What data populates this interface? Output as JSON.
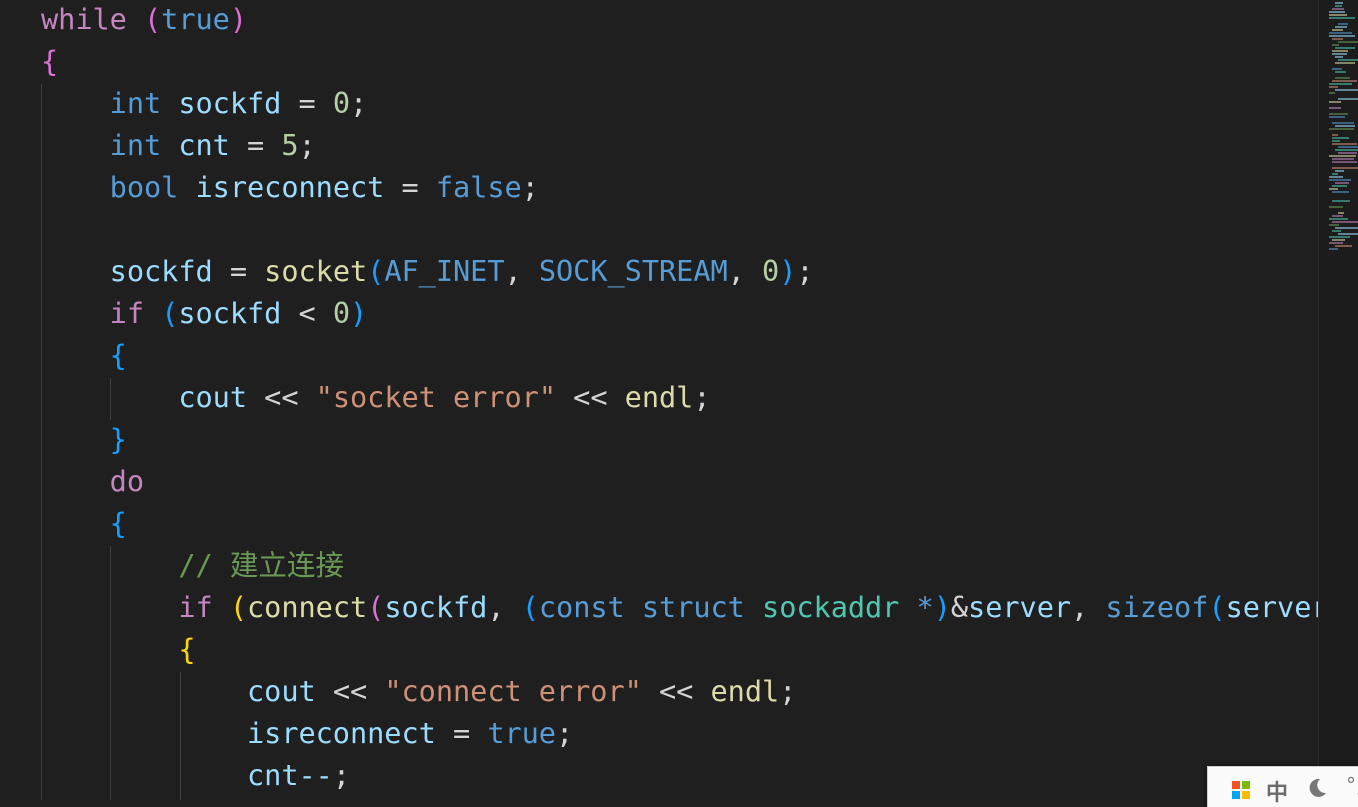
{
  "editor": {
    "language": "cpp",
    "lines": [
      [
        {
          "t": "while",
          "c": "kw-ctrl"
        },
        {
          "t": " ",
          "c": "op"
        },
        {
          "t": "(",
          "c": "p1"
        },
        {
          "t": "true",
          "c": "kw"
        },
        {
          "t": ")",
          "c": "p1"
        }
      ],
      [
        {
          "t": "{",
          "c": "p1"
        }
      ],
      [
        {
          "t": "    ",
          "c": "op"
        },
        {
          "t": "int",
          "c": "kw"
        },
        {
          "t": " ",
          "c": "op"
        },
        {
          "t": "sockfd",
          "c": "var"
        },
        {
          "t": " = ",
          "c": "op"
        },
        {
          "t": "0",
          "c": "num"
        },
        {
          "t": ";",
          "c": "op"
        }
      ],
      [
        {
          "t": "    ",
          "c": "op"
        },
        {
          "t": "int",
          "c": "kw"
        },
        {
          "t": " ",
          "c": "op"
        },
        {
          "t": "cnt",
          "c": "var"
        },
        {
          "t": " = ",
          "c": "op"
        },
        {
          "t": "5",
          "c": "num"
        },
        {
          "t": ";",
          "c": "op"
        }
      ],
      [
        {
          "t": "    ",
          "c": "op"
        },
        {
          "t": "bool",
          "c": "kw"
        },
        {
          "t": " ",
          "c": "op"
        },
        {
          "t": "isreconnect",
          "c": "var"
        },
        {
          "t": " = ",
          "c": "op"
        },
        {
          "t": "false",
          "c": "kw"
        },
        {
          "t": ";",
          "c": "op"
        }
      ],
      [],
      [
        {
          "t": "    ",
          "c": "op"
        },
        {
          "t": "sockfd",
          "c": "var"
        },
        {
          "t": " = ",
          "c": "op"
        },
        {
          "t": "socket",
          "c": "fn"
        },
        {
          "t": "(",
          "c": "p2"
        },
        {
          "t": "AF_INET",
          "c": "kw"
        },
        {
          "t": ", ",
          "c": "op"
        },
        {
          "t": "SOCK_STREAM",
          "c": "kw"
        },
        {
          "t": ", ",
          "c": "op"
        },
        {
          "t": "0",
          "c": "num"
        },
        {
          "t": ")",
          "c": "p2"
        },
        {
          "t": ";",
          "c": "op"
        }
      ],
      [
        {
          "t": "    ",
          "c": "op"
        },
        {
          "t": "if",
          "c": "kw-ctrl"
        },
        {
          "t": " ",
          "c": "op"
        },
        {
          "t": "(",
          "c": "p2"
        },
        {
          "t": "sockfd",
          "c": "var"
        },
        {
          "t": " < ",
          "c": "op"
        },
        {
          "t": "0",
          "c": "num"
        },
        {
          "t": ")",
          "c": "p2"
        }
      ],
      [
        {
          "t": "    ",
          "c": "op"
        },
        {
          "t": "{",
          "c": "p2"
        }
      ],
      [
        {
          "t": "        ",
          "c": "op"
        },
        {
          "t": "cout",
          "c": "var"
        },
        {
          "t": " << ",
          "c": "op"
        },
        {
          "t": "\"socket error\"",
          "c": "str"
        },
        {
          "t": " << ",
          "c": "op"
        },
        {
          "t": "endl",
          "c": "fn"
        },
        {
          "t": ";",
          "c": "op"
        }
      ],
      [
        {
          "t": "    ",
          "c": "op"
        },
        {
          "t": "}",
          "c": "p2"
        }
      ],
      [
        {
          "t": "    ",
          "c": "op"
        },
        {
          "t": "do",
          "c": "kw-ctrl"
        }
      ],
      [
        {
          "t": "    ",
          "c": "op"
        },
        {
          "t": "{",
          "c": "p2"
        }
      ],
      [
        {
          "t": "        ",
          "c": "op"
        },
        {
          "t": "// 建立连接",
          "c": "cmt"
        }
      ],
      [
        {
          "t": "        ",
          "c": "op"
        },
        {
          "t": "if",
          "c": "kw-ctrl"
        },
        {
          "t": " ",
          "c": "op"
        },
        {
          "t": "(",
          "c": "p3"
        },
        {
          "t": "connect",
          "c": "fn"
        },
        {
          "t": "(",
          "c": "p1"
        },
        {
          "t": "sockfd",
          "c": "var"
        },
        {
          "t": ", ",
          "c": "op"
        },
        {
          "t": "(",
          "c": "p2"
        },
        {
          "t": "const",
          "c": "kw"
        },
        {
          "t": " ",
          "c": "op"
        },
        {
          "t": "struct",
          "c": "kw"
        },
        {
          "t": " ",
          "c": "op"
        },
        {
          "t": "sockaddr",
          "c": "type"
        },
        {
          "t": " ",
          "c": "op"
        },
        {
          "t": "*",
          "c": "kw"
        },
        {
          "t": ")",
          "c": "p2"
        },
        {
          "t": "&",
          "c": "op"
        },
        {
          "t": "server",
          "c": "var"
        },
        {
          "t": ", ",
          "c": "op"
        },
        {
          "t": "sizeof",
          "c": "kw"
        },
        {
          "t": "(",
          "c": "p2"
        },
        {
          "t": "server",
          "c": "var"
        }
      ],
      [
        {
          "t": "        ",
          "c": "op"
        },
        {
          "t": "{",
          "c": "p3"
        }
      ],
      [
        {
          "t": "            ",
          "c": "op"
        },
        {
          "t": "cout",
          "c": "var"
        },
        {
          "t": " << ",
          "c": "op"
        },
        {
          "t": "\"connect error\"",
          "c": "str"
        },
        {
          "t": " << ",
          "c": "op"
        },
        {
          "t": "endl",
          "c": "fn"
        },
        {
          "t": ";",
          "c": "op"
        }
      ],
      [
        {
          "t": "            ",
          "c": "op"
        },
        {
          "t": "isreconnect",
          "c": "var"
        },
        {
          "t": " = ",
          "c": "op"
        },
        {
          "t": "true",
          "c": "kw"
        },
        {
          "t": ";",
          "c": "op"
        }
      ],
      [
        {
          "t": "            ",
          "c": "op"
        },
        {
          "t": "cnt--",
          "c": "var"
        },
        {
          "t": ";",
          "c": "op"
        }
      ]
    ]
  },
  "colors": {
    "background": "#1f1f1f",
    "keyword": "#569cd6",
    "control_keyword": "#c586c0",
    "variable": "#9cdcfe",
    "number": "#b5cea8",
    "function": "#dcdcaa",
    "string": "#ce9178",
    "comment": "#6a9955",
    "type": "#4ec9b0"
  },
  "ime_bar": {
    "logo_icon": "windows-logo-icon",
    "mode_label": "中",
    "theme_icon": "moon-icon",
    "punct_label": "°,"
  }
}
